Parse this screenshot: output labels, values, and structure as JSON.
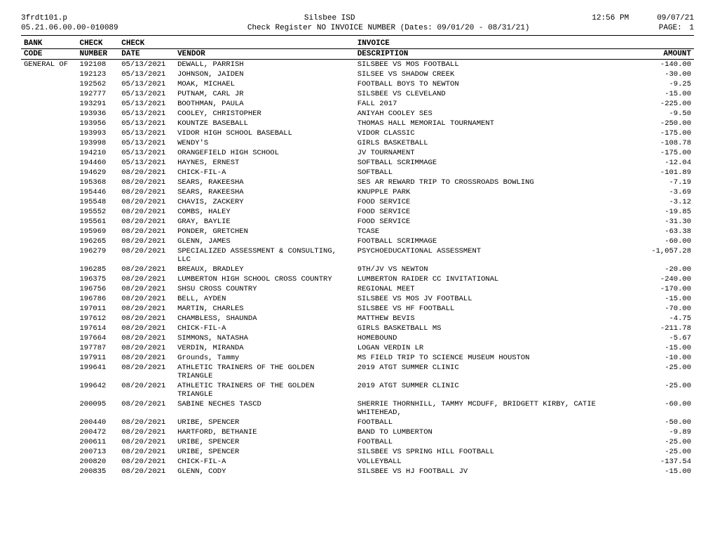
{
  "report": {
    "program": "3frdt101.p",
    "system": "Silsbee ISD",
    "time": "12:56 PM",
    "date": "09/07/21",
    "report_id": "05.21.06.00.00-010089",
    "title": "Check Register NO INVOICE NUMBER (Dates: 09/01/20 - 08/31/21)",
    "page_label": "PAGE:",
    "page_num": "1"
  },
  "columns": {
    "bank": "BANK",
    "check_number": "CHECK",
    "check_date": "CHECK",
    "code": "CODE",
    "number": "NUMBER",
    "date": "DATE",
    "vendor": "VENDOR",
    "invoice": "INVOICE",
    "description": "DESCRIPTION",
    "amount": "AMOUNT"
  },
  "rows": [
    {
      "bank": "GENERAL OF",
      "number": "192108",
      "date": "05/13/2021",
      "vendor": "DEWALL, PARRISH",
      "description": "SILSBEE VS MOS FOOTBALL",
      "amount": "-140.00"
    },
    {
      "bank": "",
      "number": "192123",
      "date": "05/13/2021",
      "vendor": "JOHNSON, JAIDEN",
      "description": "SILSEE VS SHADOW CREEK",
      "amount": "-30.00"
    },
    {
      "bank": "",
      "number": "192562",
      "date": "05/13/2021",
      "vendor": "MOAK, MICHAEL",
      "description": "FOOTBALL BOYS TO NEWTON",
      "amount": "-9.25"
    },
    {
      "bank": "",
      "number": "192777",
      "date": "05/13/2021",
      "vendor": "PUTNAM, CARL JR",
      "description": "SILSBEE VS CLEVELAND",
      "amount": "-15.00"
    },
    {
      "bank": "",
      "number": "193291",
      "date": "05/13/2021",
      "vendor": "BOOTHMAN, PAULA",
      "description": "FALL 2017",
      "amount": "-225.00"
    },
    {
      "bank": "",
      "number": "193936",
      "date": "05/13/2021",
      "vendor": "COOLEY, CHRISTOPHER",
      "description": "ANIYAH COOLEY SES",
      "amount": "-9.50"
    },
    {
      "bank": "",
      "number": "193956",
      "date": "05/13/2021",
      "vendor": "KOUNTZE BASEBALL",
      "description": "THOMAS HALL MEMORIAL TOURNAMENT",
      "amount": "-250.00"
    },
    {
      "bank": "",
      "number": "193993",
      "date": "05/13/2021",
      "vendor": "VIDOR HIGH SCHOOL BASEBALL",
      "description": "VIDOR CLASSIC",
      "amount": "-175.00"
    },
    {
      "bank": "",
      "number": "193998",
      "date": "05/13/2021",
      "vendor": "WENDY'S",
      "description": "GIRLS BASKETBALL",
      "amount": "-108.78"
    },
    {
      "bank": "",
      "number": "194210",
      "date": "05/13/2021",
      "vendor": "ORANGEFIELD HIGH SCHOOL",
      "description": "JV TOURNAMENT",
      "amount": "-175.00"
    },
    {
      "bank": "",
      "number": "194460",
      "date": "05/13/2021",
      "vendor": "HAYNES, ERNEST",
      "description": "SOFTBALL SCRIMMAGE",
      "amount": "-12.04"
    },
    {
      "bank": "",
      "number": "194629",
      "date": "08/20/2021",
      "vendor": "CHICK-FIL-A",
      "description": "SOFTBALL",
      "amount": "-101.89"
    },
    {
      "bank": "",
      "number": "195368",
      "date": "08/20/2021",
      "vendor": "SEARS, RAKEESHA",
      "description": "SES AR REWARD TRIP TO CROSSROADS BOWLING",
      "amount": "-7.19"
    },
    {
      "bank": "",
      "number": "195446",
      "date": "08/20/2021",
      "vendor": "SEARS, RAKEESHA",
      "description": "KNUPPLE PARK",
      "amount": "-3.69"
    },
    {
      "bank": "",
      "number": "195548",
      "date": "08/20/2021",
      "vendor": "CHAVIS, ZACKERY",
      "description": "FOOD SERVICE",
      "amount": "-3.12"
    },
    {
      "bank": "",
      "number": "195552",
      "date": "08/20/2021",
      "vendor": "COMBS, HALEY",
      "description": "FOOD SERVICE",
      "amount": "-19.85"
    },
    {
      "bank": "",
      "number": "195561",
      "date": "08/20/2021",
      "vendor": "GRAY, BAYLIE",
      "description": "FOOD SERVICE",
      "amount": "-31.30"
    },
    {
      "bank": "",
      "number": "195969",
      "date": "08/20/2021",
      "vendor": "PONDER, GRETCHEN",
      "description": "TCASE",
      "amount": "-63.38"
    },
    {
      "bank": "",
      "number": "196265",
      "date": "08/20/2021",
      "vendor": "GLENN, JAMES",
      "description": "FOOTBALL SCRIMMAGE",
      "amount": "-60.00"
    },
    {
      "bank": "",
      "number": "196279",
      "date": "08/20/2021",
      "vendor": "SPECIALIZED ASSESSMENT & CONSULTING, LLC",
      "description": "PSYCHOEDUCATIONAL ASSESSMENT",
      "amount": "-1,057.28"
    },
    {
      "bank": "",
      "number": "196285",
      "date": "08/20/2021",
      "vendor": "BREAUX, BRADLEY",
      "description": "9TH/JV VS NEWTON",
      "amount": "-20.00"
    },
    {
      "bank": "",
      "number": "196375",
      "date": "08/20/2021",
      "vendor": "LUMBERTON HIGH SCHOOL CROSS COUNTRY",
      "description": "LUMBERTON RAIDER CC INVITATIONAL",
      "amount": "-240.00"
    },
    {
      "bank": "",
      "number": "196756",
      "date": "08/20/2021",
      "vendor": "SHSU CROSS COUNTRY",
      "description": "REGIONAL MEET",
      "amount": "-170.00"
    },
    {
      "bank": "",
      "number": "196786",
      "date": "08/20/2021",
      "vendor": "BELL, AYDEN",
      "description": "SILSBEE VS MOS JV FOOTBALL",
      "amount": "-15.00"
    },
    {
      "bank": "",
      "number": "197011",
      "date": "08/20/2021",
      "vendor": "MARTIN, CHARLES",
      "description": "SILSBEE VS HF FOOTBALL",
      "amount": "-70.00"
    },
    {
      "bank": "",
      "number": "197612",
      "date": "08/20/2021",
      "vendor": "CHAMBLESS, SHAUNDA",
      "description": "MATTHEW BEVIS",
      "amount": "-4.75"
    },
    {
      "bank": "",
      "number": "197614",
      "date": "08/20/2021",
      "vendor": "CHICK-FIL-A",
      "description": "GIRLS BASKETBALL MS",
      "amount": "-211.78"
    },
    {
      "bank": "",
      "number": "197664",
      "date": "08/20/2021",
      "vendor": "SIMMONS, NATASHA",
      "description": "HOMEBOUND",
      "amount": "-5.67"
    },
    {
      "bank": "",
      "number": "197787",
      "date": "08/20/2021",
      "vendor": "VERDIN, MIRANDA",
      "description": "LOGAN VERDIN LR",
      "amount": "-15.00"
    },
    {
      "bank": "",
      "number": "197911",
      "date": "08/20/2021",
      "vendor": "Grounds, Tammy",
      "description": "MS FIELD TRIP TO SCIENCE MUSEUM HOUSTON",
      "amount": "-10.00"
    },
    {
      "bank": "",
      "number": "199641",
      "date": "08/20/2021",
      "vendor": "ATHLETIC TRAINERS OF THE GOLDEN TRIANGLE",
      "description": "2019 ATGT SUMMER CLINIC",
      "amount": "-25.00"
    },
    {
      "bank": "",
      "number": "199642",
      "date": "08/20/2021",
      "vendor": "ATHLETIC TRAINERS OF THE GOLDEN TRIANGLE",
      "description": "2019 ATGT SUMMER CLINIC",
      "amount": "-25.00"
    },
    {
      "bank": "",
      "number": "200095",
      "date": "08/20/2021",
      "vendor": "SABINE NECHES TASCD",
      "description": "SHERRIE THORNHILL, TAMMY MCDUFF, BRIDGETT KIRBY, CATIE WHITEHEAD,",
      "amount": "-60.00"
    },
    {
      "bank": "",
      "number": "200440",
      "date": "08/20/2021",
      "vendor": "URIBE, SPENCER",
      "description": "FOOTBALL",
      "amount": "-50.00"
    },
    {
      "bank": "",
      "number": "200472",
      "date": "08/20/2021",
      "vendor": "HARTFORD, BETHANIE",
      "description": "BAND TO LUMBERTON",
      "amount": "-9.89"
    },
    {
      "bank": "",
      "number": "200611",
      "date": "08/20/2021",
      "vendor": "URIBE, SPENCER",
      "description": "FOOTBALL",
      "amount": "-25.00"
    },
    {
      "bank": "",
      "number": "200713",
      "date": "08/20/2021",
      "vendor": "URIBE, SPENCER",
      "description": "SILSBEE VS SPRING HILL FOOTBALL",
      "amount": "-25.00"
    },
    {
      "bank": "",
      "number": "200820",
      "date": "08/20/2021",
      "vendor": "CHICK-FIL-A",
      "description": "VOLLEYBALL",
      "amount": "-137.54"
    },
    {
      "bank": "",
      "number": "200835",
      "date": "08/20/2021",
      "vendor": "GLENN, CODY",
      "description": "SILSBEE VS HJ FOOTBALL JV",
      "amount": "-15.00"
    }
  ]
}
